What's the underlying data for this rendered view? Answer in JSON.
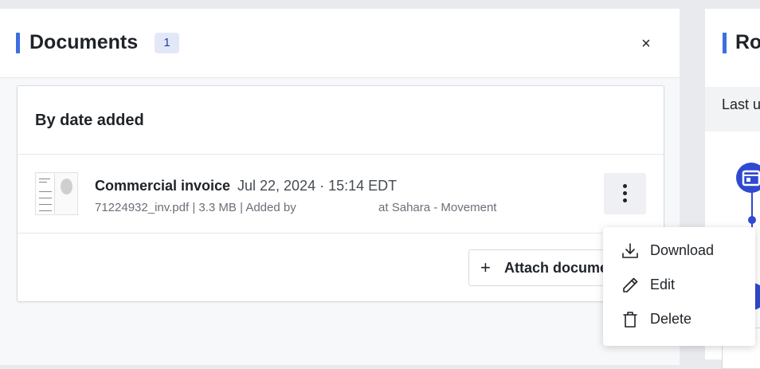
{
  "documents_panel": {
    "title": "Documents",
    "count": "1",
    "close_label": "×",
    "section_title": "By date added",
    "document": {
      "name": "Commercial invoice",
      "date": "Jul 22, 2024 · 15:14 EDT",
      "meta_before": "71224932_inv.pdf | 3.3 MB | Added by",
      "meta_after": "at Sahara - Movement"
    },
    "attach_button": {
      "plus": "+",
      "label": "Attach documents"
    }
  },
  "context_menu": {
    "items": [
      {
        "label": "Download",
        "icon": "download-icon"
      },
      {
        "label": "Edit",
        "icon": "pencil-icon"
      },
      {
        "label": "Delete",
        "icon": "trash-icon"
      }
    ]
  },
  "side_panel": {
    "title": "Ro",
    "subtitle": "Last u"
  },
  "colors": {
    "accent": "#3b6fe0",
    "badge_bg": "#e3e8f8",
    "timeline": "#2f4ad0"
  }
}
